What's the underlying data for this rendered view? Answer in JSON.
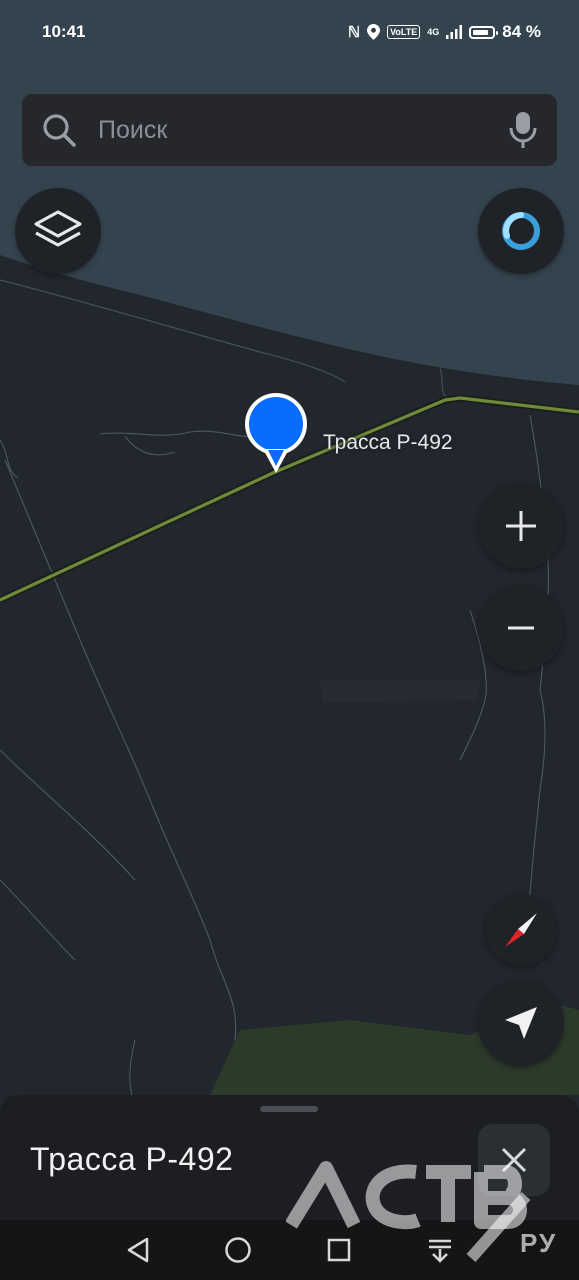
{
  "status_bar": {
    "time": "10:41",
    "volte": "VoLTE",
    "network": "4G",
    "battery": "84 %",
    "battery_level": 0.84
  },
  "search": {
    "placeholder": "Поиск",
    "icon": "search-icon",
    "voice_icon": "microphone-icon"
  },
  "map": {
    "marker_label": "Трасса Р-492",
    "marker_color": "#0a6cff",
    "road_color": "#6f8a3a",
    "sea_color": "#34444f",
    "land_color": "#22262d"
  },
  "controls": {
    "layers_icon": "layers-icon",
    "alice_icon": "alice-assistant-icon",
    "zoom_in_icon": "plus-icon",
    "zoom_out_icon": "minus-icon",
    "compass_icon": "compass-icon",
    "locate_icon": "navigation-arrow-icon"
  },
  "bottom_sheet": {
    "title": "Трасса Р-492",
    "close_icon": "close-icon"
  },
  "watermark": {
    "logo": "АСТВ",
    "suffix": "РУ"
  },
  "nav_bar": {
    "items": [
      "back-icon",
      "home-icon",
      "recents-icon",
      "notifications-icon"
    ]
  }
}
